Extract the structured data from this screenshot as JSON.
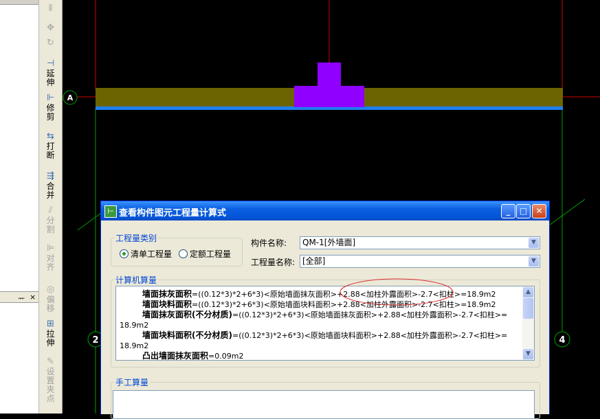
{
  "toolbar": {
    "items": [
      {
        "icon": "mirror-icon",
        "label": ""
      },
      {
        "icon": "move-icon",
        "label": ""
      },
      {
        "icon": "rotate-icon",
        "label": ""
      },
      {
        "icon": "extend-icon",
        "label": "延伸"
      },
      {
        "icon": "trim-icon",
        "label": "修剪"
      },
      {
        "icon": "break-icon",
        "label": "打断"
      },
      {
        "icon": "merge-icon",
        "label": "合并"
      },
      {
        "icon": "split-icon",
        "label": "分割"
      },
      {
        "icon": "align-icon",
        "label": "对齐"
      },
      {
        "icon": "offset-icon",
        "label": "偏移"
      },
      {
        "icon": "stretch-icon",
        "label": "拉伸"
      },
      {
        "icon": "set-insertion-point-icon",
        "label": "设置夹点"
      }
    ]
  },
  "left_panel": {
    "pin": "ᅲ",
    "close": "×"
  },
  "canvas": {
    "axis_labels": {
      "row_a": "A",
      "col_2": "2",
      "col_4": "4"
    },
    "colors": {
      "wall": "#6b6400",
      "wall_base": "#1e7ff0",
      "column": "#8f00ff",
      "grid_red": "#d00000",
      "grid_green": "#00a000"
    }
  },
  "dialog": {
    "title": "查看构件图元工程量计算式",
    "quantity_type": {
      "legend": "工程量类别",
      "options": [
        "清单工程量",
        "定额工程量"
      ],
      "selected": "清单工程量"
    },
    "component_name_label": "构件名称:",
    "component_name_value": "QM-1[外墙面]",
    "quantity_name_label": "工程量名称:",
    "quantity_name_value": "[全部]",
    "computed": {
      "legend": "计算机算量",
      "lines": [
        {
          "name": "墙面抹灰面积",
          "formula": "=((0.12*3)*2+6*3)<原始墙面抹灰面积>+2.88<加柱外露面积>-2.7<扣柱>=18.9m2"
        },
        {
          "name": "墙面块料面积",
          "formula": "=((0.12*3)*2+6*3)<原始墙面块料面积>+2.88<加柱外露面积>-2.7<扣柱>=18.9m2"
        },
        {
          "name": "墙面抹灰面积(不分材质)",
          "formula": "=((0.12*3)*2+6*3)<原始墙面抹灰面积>+2.88<加柱外露面积>-2.7<扣柱>=",
          "cont": "18.9m2"
        },
        {
          "name": "墙面块料面积(不分材质)",
          "formula": "=((0.12*3)*2+6*3)<原始墙面块料面积>+2.88<加柱外露面积>-2.7<扣柱>=",
          "cont": "18.9m2"
        },
        {
          "name": "凸出墙面抹灰面积",
          "formula": "=0.09m2"
        }
      ]
    },
    "manual": {
      "legend": "手工算量"
    }
  }
}
